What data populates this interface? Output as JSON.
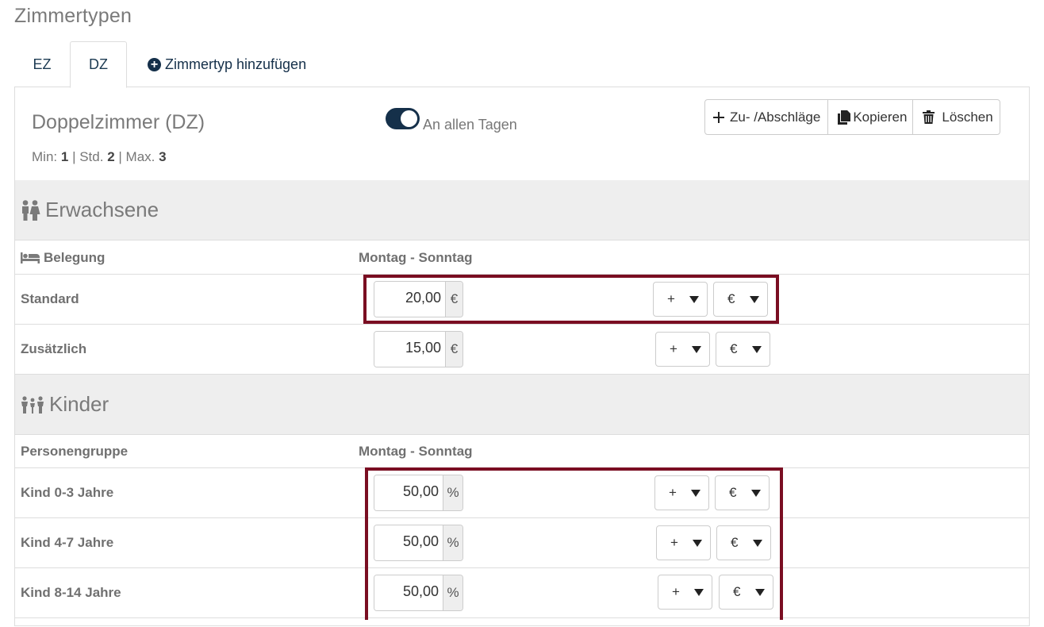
{
  "page": {
    "heading": "Zimmertypen"
  },
  "tabs": [
    {
      "label": "EZ",
      "active": false
    },
    {
      "label": "DZ",
      "active": true
    }
  ],
  "add_tab_label": "Zimmertyp hinzufügen",
  "room": {
    "title": "Doppelzimmer (DZ)",
    "min_label": "Min:",
    "min": "1",
    "std_label": "| Std.",
    "std": "2",
    "max_label": "| Max.",
    "max": "3",
    "toggle_label": "An allen Tagen",
    "toggle_on": true
  },
  "toolbar": {
    "surcharge_label": "Zu- /Abschläge",
    "copy_label": "Kopieren",
    "delete_label": "Löschen"
  },
  "adults": {
    "title": "Erwachsene",
    "col1": "Belegung",
    "col2": "Montag - Sonntag",
    "rows": [
      {
        "label": "Standard",
        "value": "20,00",
        "unit": "€",
        "sign": "+",
        "mode": "€"
      },
      {
        "label": "Zusätzlich",
        "value": "15,00",
        "unit": "€",
        "sign": "+",
        "mode": "€"
      }
    ]
  },
  "children": {
    "title": "Kinder",
    "col1": "Personengruppe",
    "col2": "Montag - Sonntag",
    "rows": [
      {
        "label": "Kind 0-3 Jahre",
        "value": "50,00",
        "unit": "%",
        "sign": "+",
        "mode": "€"
      },
      {
        "label": "Kind 4-7 Jahre",
        "value": "50,00",
        "unit": "%",
        "sign": "+",
        "mode": "€"
      },
      {
        "label": "Kind 8-14 Jahre",
        "value": "50,00",
        "unit": "%",
        "sign": "+",
        "mode": "€"
      }
    ]
  },
  "colors": {
    "accent": "#15304a",
    "highlight": "#7a0e22",
    "section_bg": "#eeeeee"
  }
}
